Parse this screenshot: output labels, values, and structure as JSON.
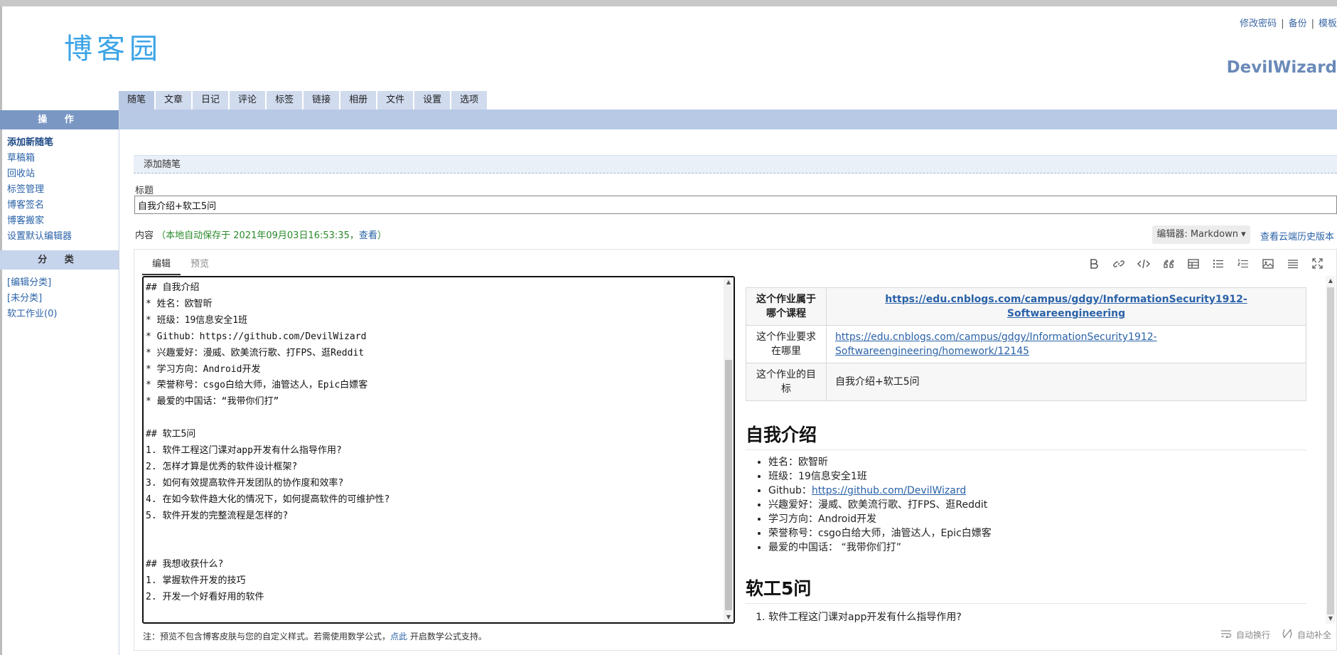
{
  "header": {
    "logo_text": "博客园",
    "links": [
      "修改密码",
      "备份",
      "模板"
    ],
    "username": "DevilWizard"
  },
  "tabs": [
    "随笔",
    "文章",
    "日记",
    "评论",
    "标签",
    "链接",
    "相册",
    "文件",
    "设置",
    "选项"
  ],
  "sidebar": {
    "ops_title": "操 作",
    "ops_items": [
      "添加新随笔",
      "草稿箱",
      "回收站",
      "标签管理",
      "博客签名",
      "博客搬家",
      "设置默认编辑器"
    ],
    "cat_title": "分 类",
    "cat_items": [
      "[编辑分类]",
      "[未分类]",
      "软工作业(0)"
    ]
  },
  "main": {
    "section_title": "添加随笔",
    "title_label": "标题",
    "title_value": "自我介绍+软工5问",
    "content_label": "内容",
    "autosave_text": "（本地自动保存于 2021年09月03日16:53:35，",
    "autosave_link": "查看",
    "autosave_end": "）",
    "editor_select": "编辑器: Markdown",
    "cloud_history": "查看云端历史版本",
    "editor_tabs": [
      "编辑",
      "预览"
    ],
    "toolbar_icons": [
      "bold-icon",
      "link-icon",
      "code-icon",
      "quote-icon",
      "table-icon",
      "unordered-list-icon",
      "ordered-list-icon",
      "image-icon",
      "align-icon",
      "fullscreen-icon"
    ]
  },
  "markdown": "## 自我介绍\n* 姓名：欧智昕\n* 班级：19信息安全1班\n* Github：https://github.com/DevilWizard\n* 兴趣爱好：漫威、欧美流行歌、打FPS、逛Reddit\n* 学习方向：Android开发\n* 荣誉称号：csgo白给大师，油管达人，Epic白嫖客\n* 最爱的中国话：“我带你们打”\n\n## 软工5问\n1. 软件工程这门课对app开发有什么指导作用?\n2. 怎样才算是优秀的软件设计框架?\n3. 如何有效提高软件开发团队的协作度和效率?\n4. 在如今软件趋大化的情况下，如何提高软件的可维护性?\n5. 软件开发的完整流程是怎样的?\n\n\n## 我想收获什么?\n1. 掌握软件开发的技巧\n2. 开发一个好看好用的软件",
  "preview": {
    "table": [
      {
        "k": "这个作业属于哪个课程",
        "v": "https://edu.cnblogs.com/campus/gdgy/InformationSecurity1912-Softwareengineering",
        "link": true
      },
      {
        "k": "这个作业要求在哪里",
        "v": "https://edu.cnblogs.com/campus/gdgy/InformationSecurity1912-Softwareengineering/homework/12145",
        "link": true
      },
      {
        "k": "这个作业的目标",
        "v": "自我介绍+软工5问",
        "link": false
      }
    ],
    "h_intro": "自我介绍",
    "intro_items": [
      {
        "pre": "姓名：欧智昕"
      },
      {
        "pre": "班级：19信息安全1班"
      },
      {
        "pre": "Github：",
        "link": "https://github.com/DevilWizard"
      },
      {
        "pre": "兴趣爱好：漫威、欧美流行歌、打FPS、逛Reddit"
      },
      {
        "pre": "学习方向：Android开发"
      },
      {
        "pre": "荣誉称号：csgo白给大师，油管达人，Epic白嫖客"
      },
      {
        "pre": "最爱的中国话： “我带你们打”"
      }
    ],
    "h_q": "软工5问",
    "q_items": [
      "软件工程这门课对app开发有什么指导作用?"
    ]
  },
  "footer": {
    "note_pre": "注：预览不包含博客皮肤与您的自定义样式。若需使用数学公式，",
    "note_link": "点此",
    "note_post": " 开启数学公式支持。",
    "auto_wrap": "自动换行",
    "auto_complete": "自动补全"
  }
}
